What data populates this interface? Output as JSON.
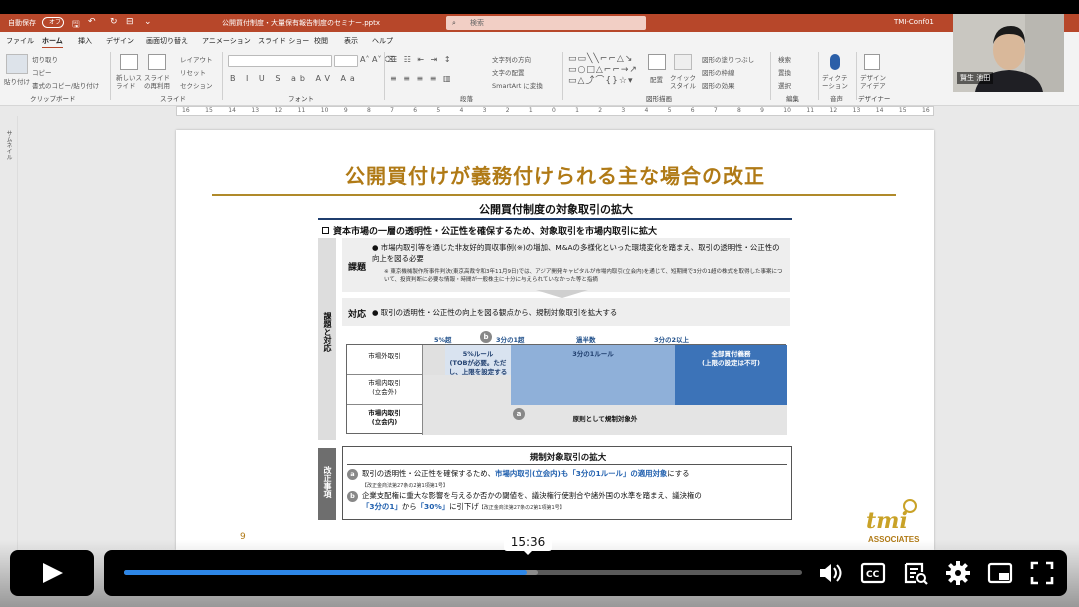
{
  "titlebar": {
    "autosave_label": "自動保存",
    "autosave_state": "オフ",
    "document_name": "公開買付制度・大量保有報告制度のセミナー.pptx",
    "search_placeholder": "検索",
    "account_name": "TMI-Conf01"
  },
  "tabs": [
    "ファイル",
    "ホーム",
    "挿入",
    "デザイン",
    "画面切り替え",
    "アニメーション",
    "スライド ショー",
    "校閲",
    "表示",
    "ヘルプ"
  ],
  "ribbon": {
    "clipboard": {
      "paste": "貼り付け",
      "cut": "切り取り",
      "copy": "コピー",
      "format_painter": "書式のコピー/貼り付け",
      "group": "クリップボード"
    },
    "slides": {
      "new_slide": "新しいスライド",
      "reuse": "スライドの再利用",
      "layout": "レイアウト",
      "reset": "リセット",
      "section": "セクション",
      "group": "スライド"
    },
    "font_group": "フォント",
    "paragraph": {
      "text_direction": "文字列の方向",
      "align_text": "文字の配置",
      "smartart": "SmartArt に変換",
      "group": "段落"
    },
    "drawing": {
      "arrange": "配置",
      "quick_styles": "クイック スタイル",
      "fill": "図形の塗りつぶし",
      "outline": "図形の枠線",
      "effects": "図形の効果",
      "group": "図形描画"
    },
    "editing": {
      "find": "検索",
      "replace": "置換",
      "select": "選択",
      "group": "編集"
    },
    "voice": {
      "dictate": "ディクテーション",
      "group": "音声"
    },
    "designer": {
      "ideas": "デザイン アイデア",
      "group": "デザイナー"
    }
  },
  "ruler_ticks": [
    "16",
    "15",
    "14",
    "13",
    "12",
    "11",
    "10",
    "9",
    "8",
    "7",
    "6",
    "5",
    "4",
    "3",
    "2",
    "1",
    "0",
    "1",
    "2",
    "3",
    "4",
    "5",
    "6",
    "7",
    "8",
    "9",
    "10",
    "11",
    "12",
    "13",
    "14",
    "15",
    "16"
  ],
  "thumbnails_label": "サムネイル",
  "slide": {
    "title": "公開買付けが義務付けられる主な場合の改正",
    "subtitle": "公開買付制度の対象取引の拡大",
    "lead": "資本市場の一層の透明性・公正性を確保するため、対象取引を市場内取引に拡大",
    "side_label": "課題と対応",
    "issue_heading": "課題",
    "issue_text": "●  市場内取引等を通じた非友好的買収事例(※)の増加、M&Aの多様化といった環境変化を踏まえ、取引の透明性・公正性の向上を図る必要",
    "issue_note": "※  東京機械製作所事件判決(東京高裁令和3年11月9日)では、アジア開発キャピタルが市場内取引(立会内)を通じて、短期間で3分の1超の株式を取得した事案について、投資判断に必要な情報・時間が一般株主に十分に与えられていなかった等と指摘",
    "response_heading": "対応",
    "response_text": "●  取引の透明性・公正性の向上を図る観点から、規制対象取引を拡大する",
    "scale": {
      "five": "5%超",
      "b": "b",
      "third": "3分の1超",
      "half": "過半数",
      "two_thirds": "3分の2以上"
    },
    "table": {
      "row1_label": "市場外取引",
      "row2_label": "市場内取引\n(立会外)",
      "row3_label": "市場内取引\n(立会内)",
      "rule5": "5%ルール\n(TOBが必要。ただし、上限を設定するTOBも可)",
      "rule_third": "3分の1ルール",
      "all_buy": "全部買付義務\n(上限の設定は不可)",
      "a": "a",
      "row3_text": "原則として規制対象外"
    },
    "lower_side_label": "改正事項",
    "lower_heading": "規制対象取引の拡大",
    "item_a": {
      "badge": "a",
      "pre": "取引の透明性・公正性を確保するため、",
      "blue": "市場内取引(立会内)も「3分の1ルール」の適用対象",
      "post": "にする",
      "ref": "【改正金商法第27条の2第1項第1号】"
    },
    "item_b": {
      "badge": "b",
      "pre": "企業支配権に重大な影響を与えるか否かの閾値を、議決権行使割合や諸外国の水準を踏まえ、議決権の",
      "blue1": "「3分の1」",
      "mid": "から",
      "blue2": "「30%」",
      "post": "に引下げ",
      "ref": "【改正金商法第27条の2第1項第1号】"
    },
    "page_number": "9",
    "logo_text": "tmi",
    "logo_sub": "ASSOCIATES"
  },
  "webcam": {
    "name": "賢生 池田"
  },
  "player": {
    "time": "15:36",
    "progress": 0.595,
    "buffered": 0.61
  }
}
